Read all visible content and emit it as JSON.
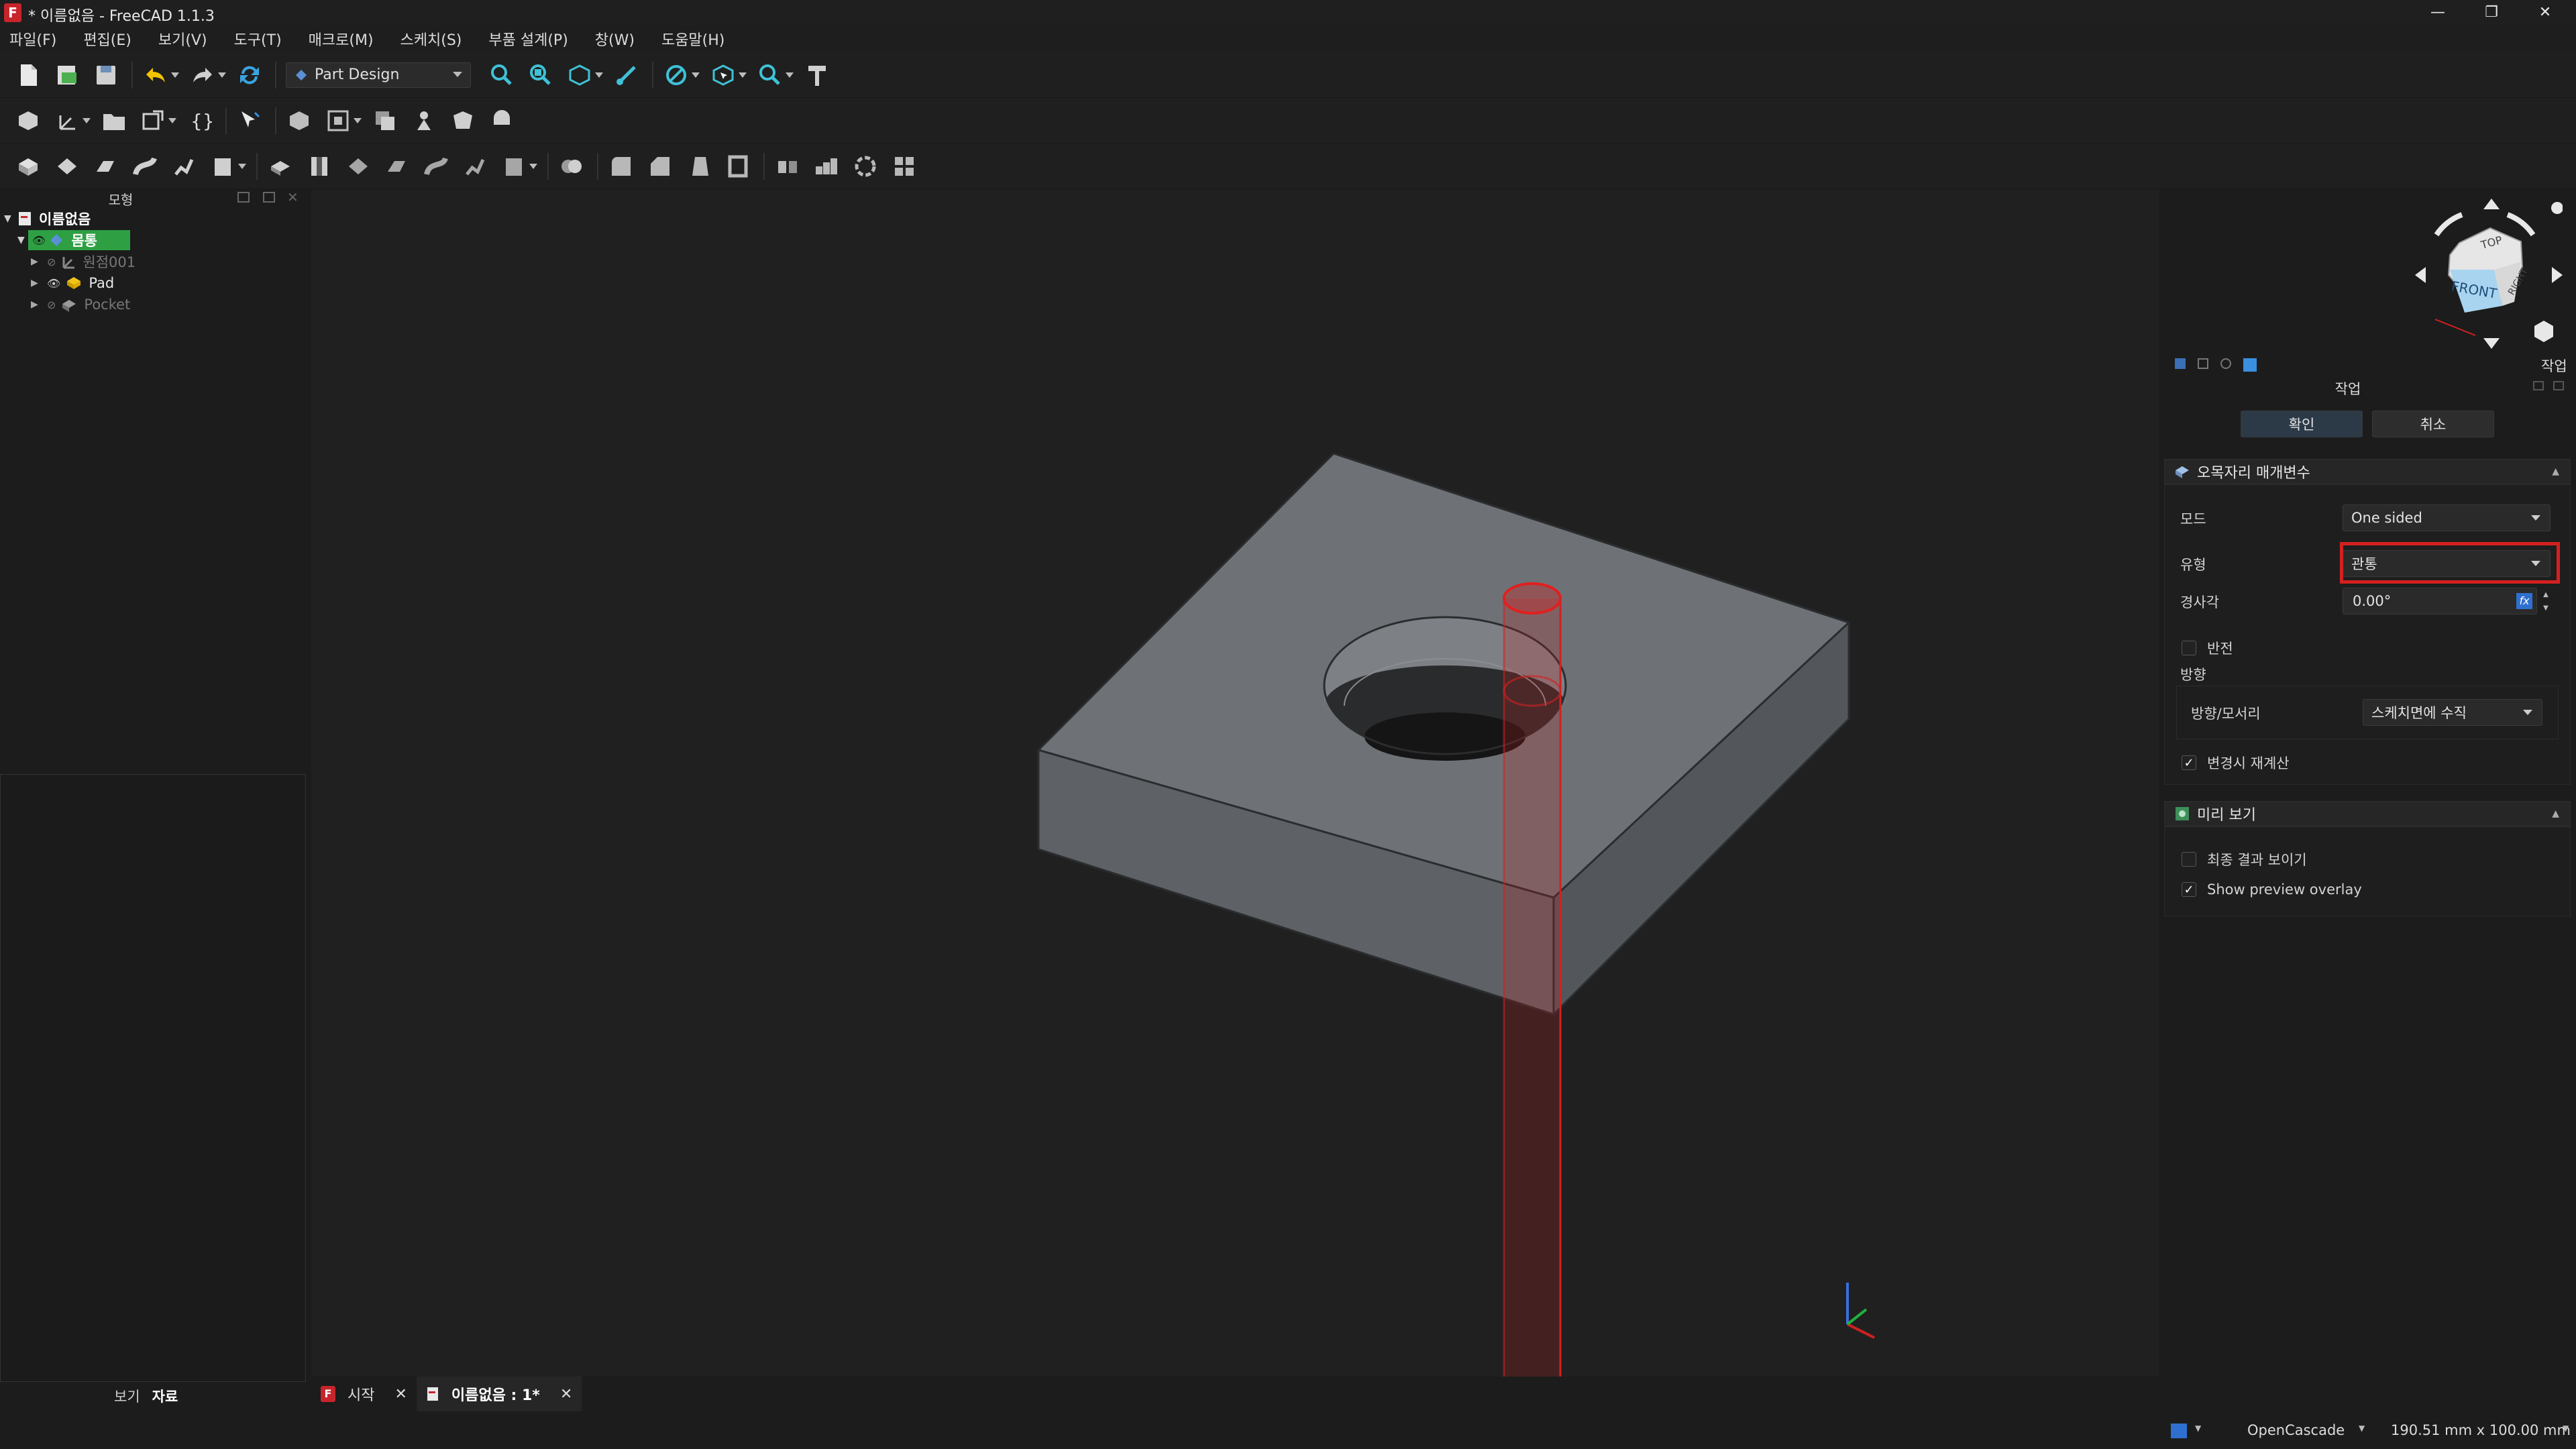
{
  "window": {
    "title": "* 이름없음 - FreeCAD 1.1.3",
    "logo_letter": "F",
    "minimize": "—",
    "restore": "❐",
    "close": "✕"
  },
  "menu": [
    "파일(F)",
    "편집(E)",
    "보기(V)",
    "도구(T)",
    "매크로(M)",
    "스케치(S)",
    "부품 설계(P)",
    "창(W)",
    "도움말(H)"
  ],
  "toolbar": {
    "workbench": "Part Design"
  },
  "model_panel": {
    "title": "모형",
    "tree": [
      {
        "label": "이름없음",
        "level": 0,
        "icon": "document-icon"
      },
      {
        "label": "몸통",
        "level": 1,
        "icon": "body-icon",
        "selected": true
      },
      {
        "label": "원점001",
        "level": 2,
        "icon": "origin-icon",
        "dim": true
      },
      {
        "label": "Pad",
        "level": 2,
        "icon": "pad-icon",
        "dim": false
      },
      {
        "label": "Pocket",
        "level": 2,
        "icon": "pocket-icon",
        "dim": true
      }
    ],
    "bottom_tabs": [
      "보기",
      "자료"
    ]
  },
  "navcube": {
    "top": "TOP",
    "front": "FRONT",
    "right": "RIGHT"
  },
  "task_panel": {
    "title": "작업",
    "tab_label": "작업",
    "ok": "확인",
    "cancel": "취소",
    "pocket_section": {
      "title": "오목자리 매개변수",
      "mode_label": "모드",
      "mode_value": "One sided",
      "type_label": "유형",
      "type_value": "관통",
      "taper_label": "경사각",
      "taper_value": "0.00°",
      "reversed_label": "반전",
      "direction_label": "방향",
      "direction_edge_label": "방향/모서리",
      "direction_edge_value": "스케치면에 수직",
      "refresh_label": "변경시 재계산",
      "refresh_checked": true,
      "reversed_checked": false
    },
    "preview_section": {
      "title": "미리 보기",
      "final_result_label": "최종 결과 보이기",
      "final_result_checked": false,
      "overlay_label": "Show preview overlay",
      "overlay_checked": true
    }
  },
  "doc_tabs": [
    {
      "label": "시작"
    },
    {
      "label": "이름없음 : 1*",
      "active": true
    }
  ],
  "status": {
    "kernel": "OpenCascade",
    "dimensions": "190.51 mm x 100.00 mm"
  },
  "colors": {
    "accent_selected": "#2ea043",
    "highlight_red": "#d42020",
    "solid_face": "#6e7276"
  }
}
